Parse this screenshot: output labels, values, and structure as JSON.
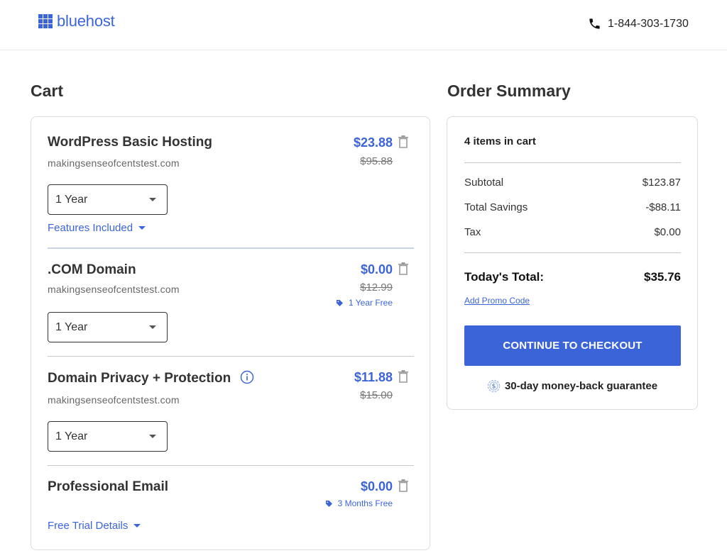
{
  "header": {
    "logo_text": "bluehost",
    "phone": "1-844-303-1730"
  },
  "cart": {
    "title": "Cart",
    "items": [
      {
        "name": "WordPress Basic Hosting",
        "domain": "makingsenseofcentstest.com",
        "price": "$23.88",
        "old_price": "$95.88",
        "term": "1 Year",
        "link": "Features Included"
      },
      {
        "name": ".COM Domain",
        "domain": "makingsenseofcentstest.com",
        "price": "$0.00",
        "old_price": "$12.99",
        "badge": "1 Year Free",
        "term": "1 Year"
      },
      {
        "name": "Domain Privacy + Protection",
        "domain": "makingsenseofcentstest.com",
        "price": "$11.88",
        "old_price": "$15.00",
        "term": "1 Year"
      },
      {
        "name": "Professional Email",
        "price": "$0.00",
        "badge": "3 Months Free",
        "link": "Free Trial Details"
      }
    ]
  },
  "summary": {
    "title": "Order Summary",
    "items_count": "4 items in cart",
    "rows": [
      {
        "label": "Subtotal",
        "value": "$123.87"
      },
      {
        "label": "Total Savings",
        "value": "-$88.11"
      },
      {
        "label": "Tax",
        "value": "$0.00"
      }
    ],
    "total_label": "Today's Total:",
    "total_value": "$35.76",
    "promo": "Add Promo Code",
    "checkout": "CONTINUE TO CHECKOUT",
    "guarantee": "30-day money-back guarantee"
  },
  "colors": {
    "brand": "#3c64d9",
    "text": "#333333",
    "muted": "#666666",
    "border": "#dcdcdc"
  },
  "icons": {
    "logo": "grid-logo-icon",
    "phone": "phone-icon",
    "trash": "trash-icon",
    "tag": "tag-icon",
    "info": "info-icon",
    "dropdown": "chevron-down-icon",
    "guarantee": "dollar-badge-icon"
  }
}
